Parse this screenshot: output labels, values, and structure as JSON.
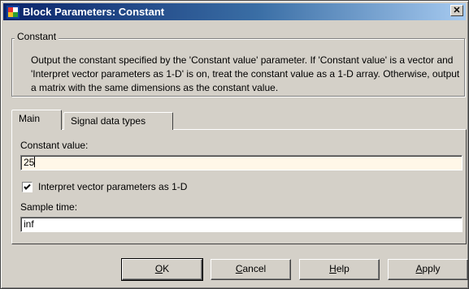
{
  "window": {
    "title": "Block Parameters: Constant",
    "close_glyph": "✕"
  },
  "group": {
    "legend": "Constant",
    "description": "Output the constant specified by the 'Constant value' parameter. If 'Constant value' is a vector and 'Interpret vector parameters as 1-D' is on, treat the constant value as a 1-D array. Otherwise, output a matrix with the same dimensions as the constant value."
  },
  "tabs": [
    {
      "label": "Main",
      "selected": true
    },
    {
      "label": "Signal data types",
      "selected": false
    }
  ],
  "main": {
    "constant_value_label": "Constant value:",
    "constant_value": "25",
    "interpret_checkbox_label": "Interpret vector parameters as 1-D",
    "interpret_checked": true,
    "sample_time_label": "Sample time:",
    "sample_time": "inf"
  },
  "buttons": {
    "ok_mnemonic": "O",
    "ok_rest": "K",
    "cancel_mnemonic": "C",
    "cancel_rest": "ancel",
    "help_mnemonic": "H",
    "help_rest": "elp",
    "apply_mnemonic": "A",
    "apply_rest": "pply"
  },
  "colors": {
    "title_gradient_start": "#0a246a",
    "title_gradient_end": "#a6caf0",
    "face": "#d4d0c8",
    "active_field": "#fff7e8"
  }
}
